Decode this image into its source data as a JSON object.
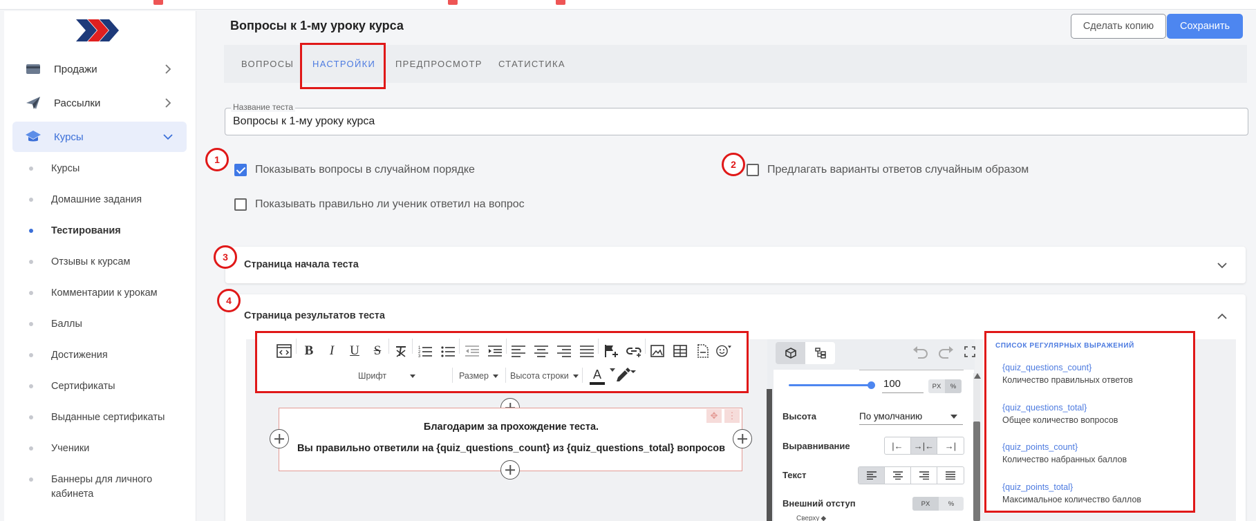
{
  "sidebar": {
    "menu": [
      {
        "label": "Продажи"
      },
      {
        "label": "Рассылки"
      },
      {
        "label": "Курсы"
      }
    ],
    "submenu": [
      "Курсы",
      "Домашние задания",
      "Тестирования",
      "Отзывы к курсам",
      "Комментарии к урокам",
      "Баллы",
      "Достижения",
      "Сертификаты",
      "Выданные сертификаты",
      "Ученики",
      "Баннеры для личного кабинета"
    ],
    "active_submenu": "Тестирования"
  },
  "header": {
    "title": "Вопросы к 1-му уроку курса",
    "copy_label": "Сделать копию",
    "save_label": "Сохранить"
  },
  "tabs": [
    {
      "label": "ВОПРОСЫ"
    },
    {
      "label": "НАСТРОЙКИ"
    },
    {
      "label": "ПРЕДПРОСМОТР"
    },
    {
      "label": "СТАТИСТИКА"
    }
  ],
  "active_tab": "НАСТРОЙКИ",
  "annotations": [
    "1",
    "2",
    "3",
    "4"
  ],
  "form": {
    "name_label": "Название теста",
    "name_value": "Вопросы к 1-му уроку курса",
    "options": [
      {
        "label": "Показывать вопросы в случайном порядке",
        "checked": true
      },
      {
        "label": "Предлагать варианты ответов случайным образом",
        "checked": false
      },
      {
        "label": "Показывать правильно ли ученик ответил на вопрос",
        "checked": false
      }
    ]
  },
  "sections": {
    "start_title": "Страница начала теста",
    "results_title": "Страница результатов теста"
  },
  "editor": {
    "font_label": "Шрифт",
    "size_label": "Размер",
    "line_height_label": "Высота строки",
    "text_color_label": "A",
    "content_line1": "Благодарим за прохождение теста.",
    "content_line2": "Вы правильно ответили на {quiz_questions_count} из {quiz_questions_total} вопросов"
  },
  "properties": {
    "width_value": "100",
    "width_unit_px": "PX",
    "width_unit_pct": "%",
    "height_label": "Высота",
    "height_value": "По умолчанию",
    "align_label": "Выравнивание",
    "text_label": "Текст",
    "margin_label": "Внешний отступ",
    "margin_unit_px": "PX",
    "margin_unit_pct": "%",
    "top_label": "Сверху"
  },
  "variables": {
    "title": "СПИСОК РЕГУЛЯРНЫХ ВЫРАЖЕНИЙ",
    "items": [
      {
        "code": "{quiz_questions_count}",
        "desc": "Количество правильных ответов"
      },
      {
        "code": "{quiz_questions_total}",
        "desc": "Общее количество вопросов"
      },
      {
        "code": "{quiz_points_count}",
        "desc": "Количество набранных баллов"
      },
      {
        "code": "{quiz_points_total}",
        "desc": "Максимальное количество баллов"
      }
    ]
  },
  "colors": {
    "accent": "#4d86f0",
    "annotation": "#e01818",
    "active_bg": "#e9eefb"
  }
}
